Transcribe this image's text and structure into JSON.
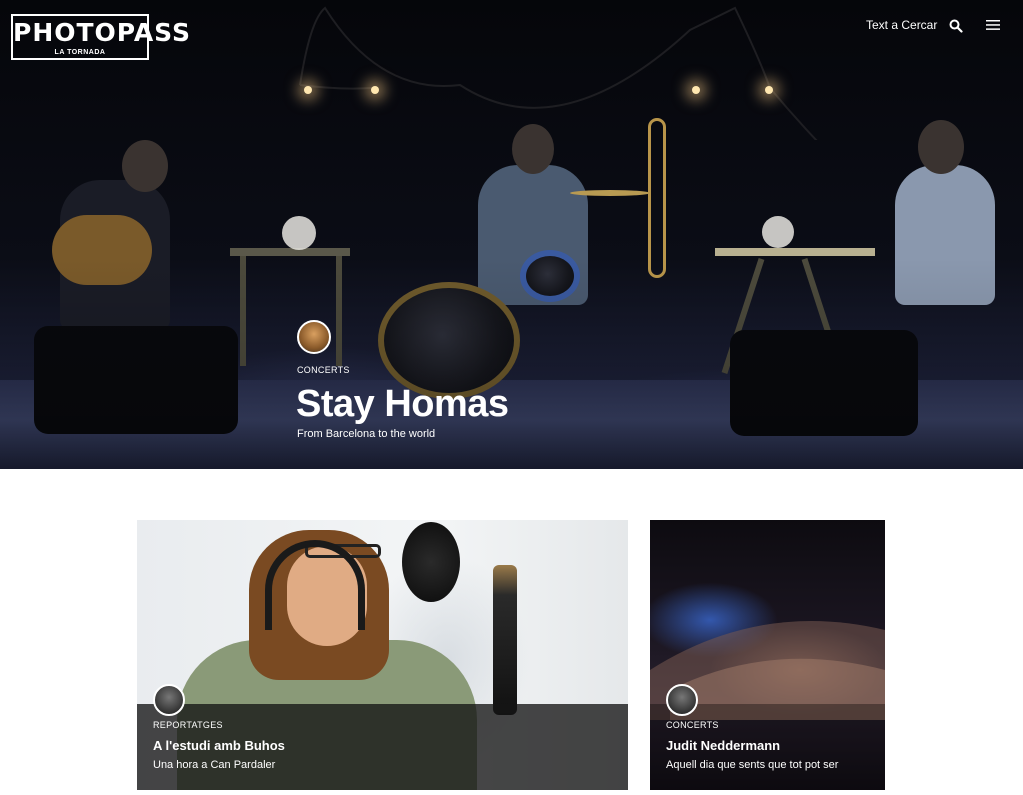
{
  "header": {
    "logo_text": "PHOTOPASS",
    "logo_subtext": "LA TORNADA",
    "search_label": "Text a Cercar",
    "search_icon": "search-icon",
    "menu_icon": "hamburger-menu-icon"
  },
  "hero": {
    "category": "CONCERTS",
    "title": "Stay Homas",
    "subtitle": "From Barcelona to the world"
  },
  "cards": [
    {
      "category": "REPORTATGES",
      "title": "A l'estudi amb Buhos",
      "subtitle": "Una hora a Can Pardaler"
    },
    {
      "category": "CONCERTS",
      "title": "Judit Neddermann",
      "subtitle": "Aquell dia que sents que tot pot ser"
    }
  ],
  "colors": {
    "text_on_image": "#ffffff",
    "page_background": "#ffffff",
    "hero_dark": "#0b0d16"
  }
}
